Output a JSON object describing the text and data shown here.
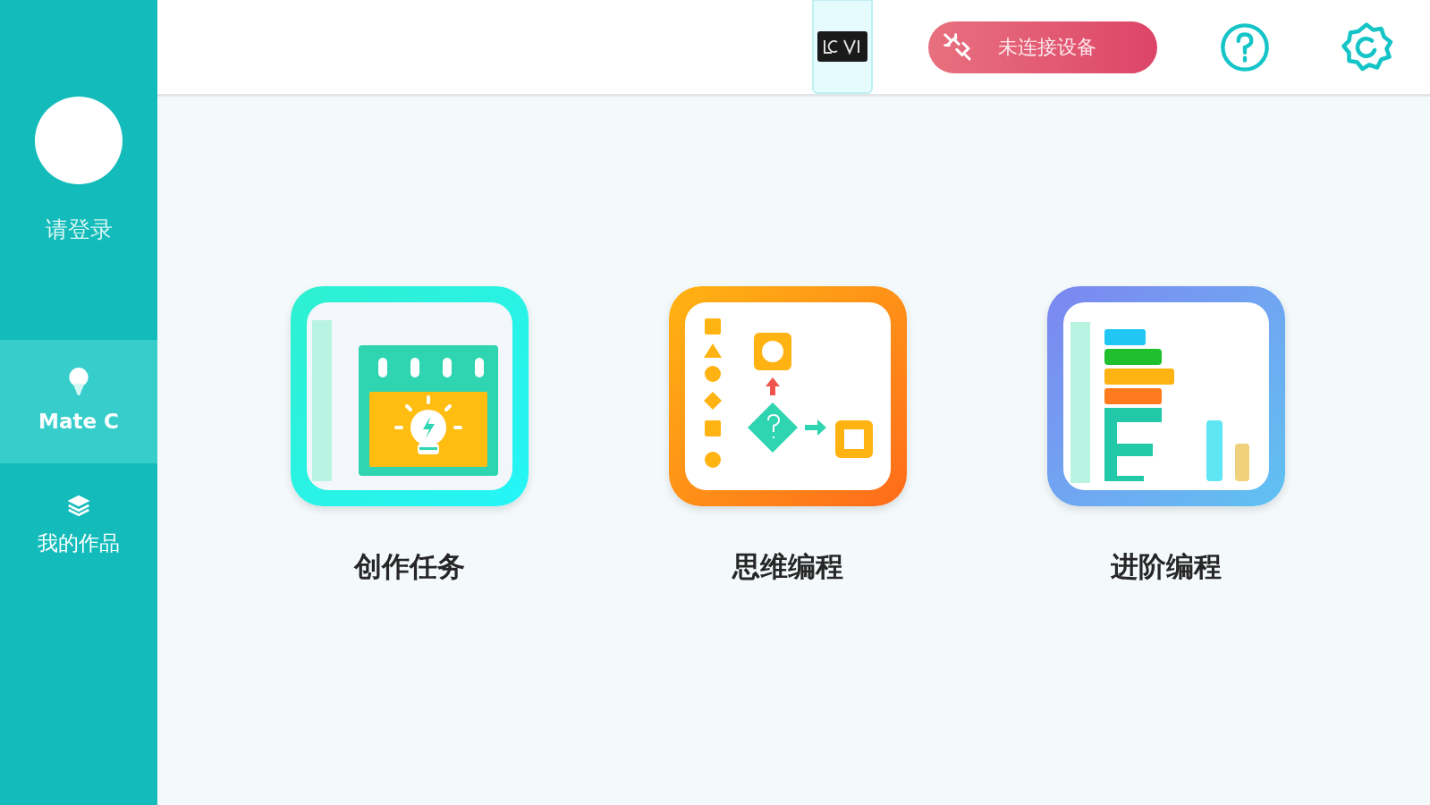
{
  "header": {
    "connection": {
      "label": "未连接设备",
      "connected": false
    }
  },
  "sidebar": {
    "user": {
      "label": "请登录"
    },
    "items": [
      {
        "label": "Mate C",
        "kind": "bulb",
        "selected": true
      },
      {
        "label": "我的作品",
        "kind": "layers",
        "selected": false
      }
    ]
  },
  "cards": [
    {
      "label": "创作任务",
      "kind": "task"
    },
    {
      "label": "思维编程",
      "kind": "flow"
    },
    {
      "label": "进阶编程",
      "kind": "blocks"
    }
  ]
}
